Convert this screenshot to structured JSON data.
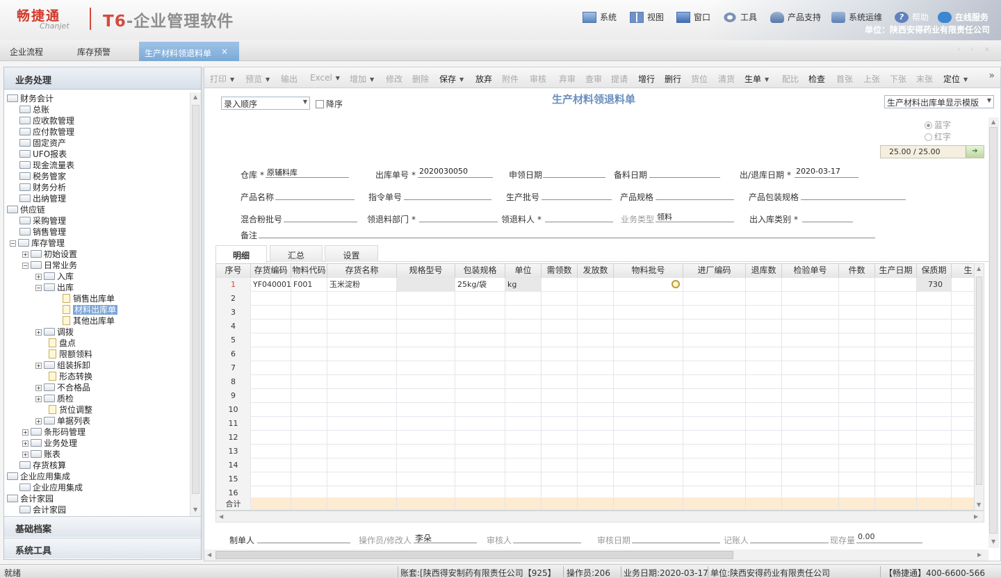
{
  "header": {
    "logo_cn": "畅捷通",
    "logo_en": "Chanjet",
    "product_t6": "T6",
    "product_rest": "-企业管理软件",
    "menu": [
      {
        "label": "系统",
        "icon": "system-icon"
      },
      {
        "label": "视图",
        "icon": "view-icon"
      },
      {
        "label": "窗口",
        "icon": "window-icon"
      },
      {
        "label": "工具",
        "icon": "tools-icon"
      },
      {
        "label": "产品支持",
        "icon": "support-icon"
      },
      {
        "label": "系统运维",
        "icon": "ops-icon"
      },
      {
        "label": "帮助",
        "icon": "help-icon"
      },
      {
        "label": "在线服务",
        "icon": "online-service-icon"
      }
    ],
    "unit": "单位：陕西安得药业有限责任公司"
  },
  "tabs": {
    "items": [
      "企业流程",
      "库存预警"
    ],
    "active": "生产材料领退料单",
    "close": "×",
    "nav": "‹ › ×"
  },
  "left_panel": {
    "title": "业务处理",
    "tree": [
      {
        "label": "财务会计"
      },
      {
        "label": "总账"
      },
      {
        "label": "应收款管理"
      },
      {
        "label": "应付款管理"
      },
      {
        "label": "固定资产"
      },
      {
        "label": "UFO报表"
      },
      {
        "label": "现金流量表"
      },
      {
        "label": "税务管家"
      },
      {
        "label": "财务分析"
      },
      {
        "label": "出纳管理"
      },
      {
        "label": "供应链"
      },
      {
        "label": "采购管理"
      },
      {
        "label": "销售管理"
      },
      {
        "label": "库存管理"
      },
      {
        "label": "初始设置"
      },
      {
        "label": "日常业务"
      },
      {
        "label": "入库"
      },
      {
        "label": "出库"
      },
      {
        "label": "销售出库单"
      },
      {
        "label": "材料出库单"
      },
      {
        "label": "其他出库单"
      },
      {
        "label": "调拨"
      },
      {
        "label": "盘点"
      },
      {
        "label": "限额领料"
      },
      {
        "label": "组装拆卸"
      },
      {
        "label": "形态转换"
      },
      {
        "label": "不合格品"
      },
      {
        "label": "质检"
      },
      {
        "label": "货位调整"
      },
      {
        "label": "单据列表"
      },
      {
        "label": "条形码管理"
      },
      {
        "label": "业务处理"
      },
      {
        "label": "账表"
      },
      {
        "label": "存货核算"
      },
      {
        "label": "企业应用集成"
      },
      {
        "label": "企业应用集成"
      },
      {
        "label": "会计家园"
      },
      {
        "label": "会计家园"
      }
    ],
    "footer_buttons": [
      "基础档案",
      "系统工具"
    ]
  },
  "toolbar": {
    "items": [
      {
        "label": "打印",
        "enabled": false,
        "dropdown": true
      },
      {
        "label": "预览",
        "enabled": false,
        "dropdown": true
      },
      {
        "label": "输出",
        "enabled": false,
        "dropdown": false
      },
      {
        "label": "Excel",
        "enabled": false,
        "dropdown": true
      },
      {
        "label": "增加",
        "enabled": false,
        "dropdown": true
      },
      {
        "label": "修改",
        "enabled": false,
        "dropdown": false
      },
      {
        "label": "删除",
        "enabled": false,
        "dropdown": false
      },
      {
        "label": "保存",
        "enabled": true,
        "dropdown": true
      },
      {
        "label": "放弃",
        "enabled": true,
        "dropdown": false
      },
      {
        "label": "附件",
        "enabled": false,
        "dropdown": false
      },
      {
        "label": "审核",
        "enabled": false,
        "dropdown": false
      },
      {
        "label": "弃审",
        "enabled": false,
        "dropdown": false
      },
      {
        "label": "查审",
        "enabled": false,
        "dropdown": false
      },
      {
        "label": "提请",
        "enabled": false,
        "dropdown": false
      },
      {
        "label": "增行",
        "enabled": true,
        "dropdown": false
      },
      {
        "label": "删行",
        "enabled": true,
        "dropdown": false
      },
      {
        "label": "货位",
        "enabled": false,
        "dropdown": false
      },
      {
        "label": "清货",
        "enabled": false,
        "dropdown": false
      },
      {
        "label": "生单",
        "enabled": true,
        "dropdown": true
      },
      {
        "label": "配比",
        "enabled": false,
        "dropdown": false
      },
      {
        "label": "检查",
        "enabled": true,
        "dropdown": false
      },
      {
        "label": "首张",
        "enabled": false,
        "dropdown": false
      },
      {
        "label": "上张",
        "enabled": false,
        "dropdown": false
      },
      {
        "label": "下张",
        "enabled": false,
        "dropdown": false
      },
      {
        "label": "末张",
        "enabled": false,
        "dropdown": false
      },
      {
        "label": "定位",
        "enabled": true,
        "dropdown": true
      }
    ],
    "more": "»"
  },
  "form": {
    "order_select": "录入顺序",
    "desc_label": "降序",
    "title": "生产材料领退料单",
    "template_select": "生产材料出库单显示模版",
    "radio_blue": "蓝字",
    "radio_red": "红字",
    "pager": "25.00  /  25.00",
    "pager_go": "➔",
    "fields": {
      "warehouse": {
        "label": "仓库",
        "value": "原辅料库"
      },
      "out_no": {
        "label": "出库单号",
        "value": "2020030050"
      },
      "req_date": {
        "label": "申领日期",
        "value": ""
      },
      "prep_date": {
        "label": "备料日期",
        "value": ""
      },
      "inout_date": {
        "label": "出/退库日期",
        "value": "2020-03-17"
      },
      "product_name": {
        "label": "产品名称",
        "value": ""
      },
      "order_no": {
        "label": "指令单号",
        "value": ""
      },
      "batch_no": {
        "label": "生产批号",
        "value": ""
      },
      "spec": {
        "label": "产品规格",
        "value": ""
      },
      "pack_spec": {
        "label": "产品包装规格",
        "value": ""
      },
      "mix_batch": {
        "label": "混合粉批号",
        "value": ""
      },
      "dept": {
        "label": "领退料部门",
        "value": ""
      },
      "person": {
        "label": "领退料人",
        "value": ""
      },
      "biz_type": {
        "label": "业务类型",
        "value": "领料"
      },
      "io_category": {
        "label": "出入库类别",
        "value": ""
      },
      "remark": {
        "label": "备注",
        "value": ""
      }
    },
    "required_mark": "*"
  },
  "detail_tabs": [
    "明细",
    "汇总",
    "设置"
  ],
  "grid": {
    "columns": [
      "序号",
      "存货编码",
      "物料代码",
      "存货名称",
      "规格型号",
      "包装规格",
      "单位",
      "需领数",
      "发放数",
      "物料批号",
      "进厂编码",
      "退库数",
      "检验单号",
      "件数",
      "生产日期",
      "保质期",
      "生"
    ],
    "row1": [
      "1",
      "YF040001",
      "F001",
      "玉米淀粉",
      "",
      "25kg/袋",
      "kg",
      "",
      "",
      "",
      "",
      "",
      "",
      "",
      "",
      "730",
      ""
    ],
    "row_numbers": [
      "2",
      "3",
      "4",
      "5",
      "6",
      "7",
      "8",
      "9",
      "10",
      "11",
      "12",
      "13",
      "14",
      "15",
      "16"
    ],
    "sum_label": "合计"
  },
  "footer": {
    "maker": {
      "label": "制单人",
      "value": ""
    },
    "operator": {
      "label": "操作员/修改人",
      "value": "李朵"
    },
    "auditor": {
      "label": "审核人",
      "value": ""
    },
    "audit_date": {
      "label": "审核日期",
      "value": ""
    },
    "bookkeeper": {
      "label": "记账人",
      "value": ""
    },
    "stock": {
      "label": "现存量",
      "value": "0.00"
    }
  },
  "status_bar": {
    "ready": "就绪",
    "account": "账套:[陕西得安制药有限责任公司【925】",
    "operator": "操作员:206",
    "biz_date": "业务日期:2020-03-17",
    "unit": "单位:陕西安得药业有限责任公司",
    "hotline": "【畅捷通】400-6600-566"
  }
}
